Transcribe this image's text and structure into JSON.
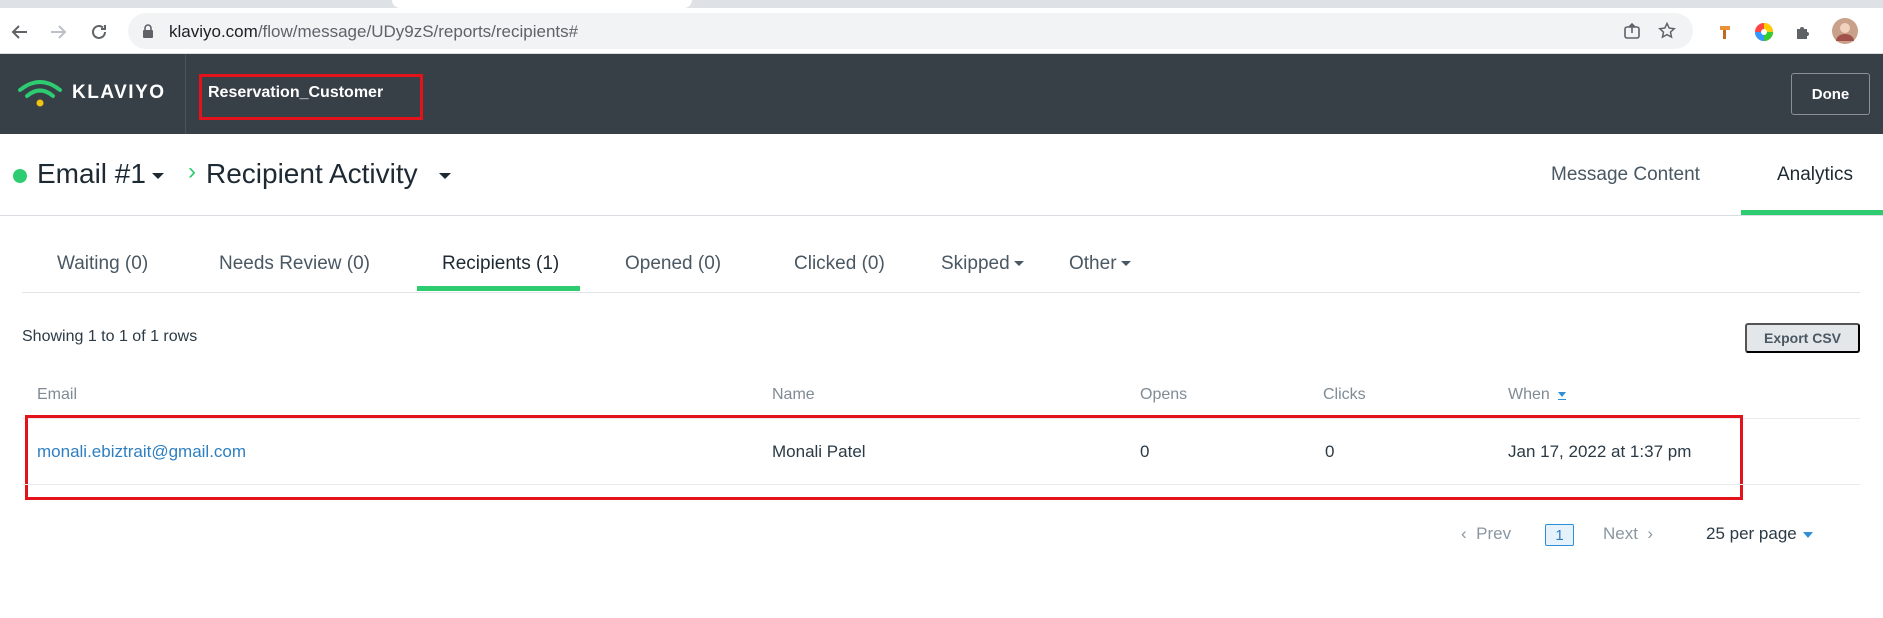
{
  "browser": {
    "url_main": "klaviyo.com",
    "url_path": "/flow/message/UDy9zS/reports/recipients#"
  },
  "header": {
    "logo_text": "KLAVIYO",
    "flow_name": "Reservation_Customer",
    "done_label": "Done"
  },
  "heading": {
    "email_title": "Email #1",
    "separator": "›",
    "activity_title": "Recipient Activity",
    "tabs": [
      "Message Content",
      "Analytics"
    ]
  },
  "recipient_tabs": [
    "Waiting (0)",
    "Needs Review (0)",
    "Recipients (1)",
    "Opened (0)",
    "Clicked (0)",
    "Skipped",
    "Other"
  ],
  "table": {
    "showing": "Showing 1 to 1 of 1 rows",
    "export_label": "Export CSV",
    "columns": [
      "Email",
      "Name",
      "Opens",
      "Clicks",
      "When"
    ],
    "rows": [
      {
        "email": "monali.ebiztrait@gmail.com",
        "name": "Monali Patel",
        "opens": "0",
        "clicks": "0",
        "when": "Jan 17, 2022 at 1:37 pm"
      }
    ]
  },
  "pagination": {
    "prev": "Prev",
    "current": "1",
    "next": "Next",
    "per_page": "25 per page"
  }
}
